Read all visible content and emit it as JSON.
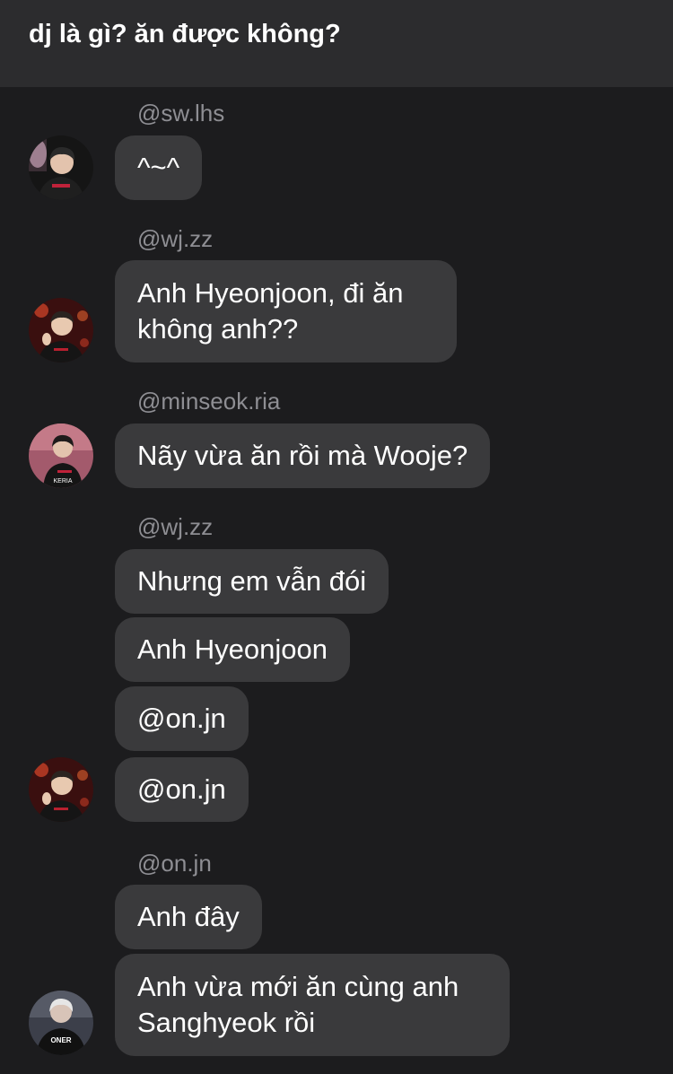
{
  "header": {
    "title": "dj là gì? ăn được không?"
  },
  "messages": [
    {
      "username": "@sw.lhs",
      "text": "^~^"
    },
    {
      "username": "@wj.zz",
      "text": "Anh Hyeonjoon, đi ăn không anh??"
    },
    {
      "username": "@minseok.ria",
      "text": "Nãy vừa ăn rồi mà Wooje?"
    },
    {
      "username": "@wj.zz",
      "texts": [
        "Nhưng em vẫn đói",
        "Anh Hyeonjoon",
        "@on.jn",
        "@on.jn"
      ]
    },
    {
      "username": "@on.jn",
      "texts": [
        "Anh đây",
        "Anh vừa mới ăn cùng anh Sanghyeok rồi"
      ]
    }
  ],
  "avatars": [
    {
      "name": "sw.lhs",
      "jersey_text": ""
    },
    {
      "name": "wj.zz",
      "jersey_text": ""
    },
    {
      "name": "minseok.ria",
      "jersey_text": "KERIA"
    },
    {
      "name": "wj.zz",
      "jersey_text": ""
    },
    {
      "name": "on.jn",
      "jersey_text": "ONER"
    }
  ],
  "colors": {
    "background": "#1c1c1e",
    "header": "#2c2c2e",
    "bubble": "#3a3a3c",
    "username": "#8e8e93",
    "text": "#ffffff"
  }
}
